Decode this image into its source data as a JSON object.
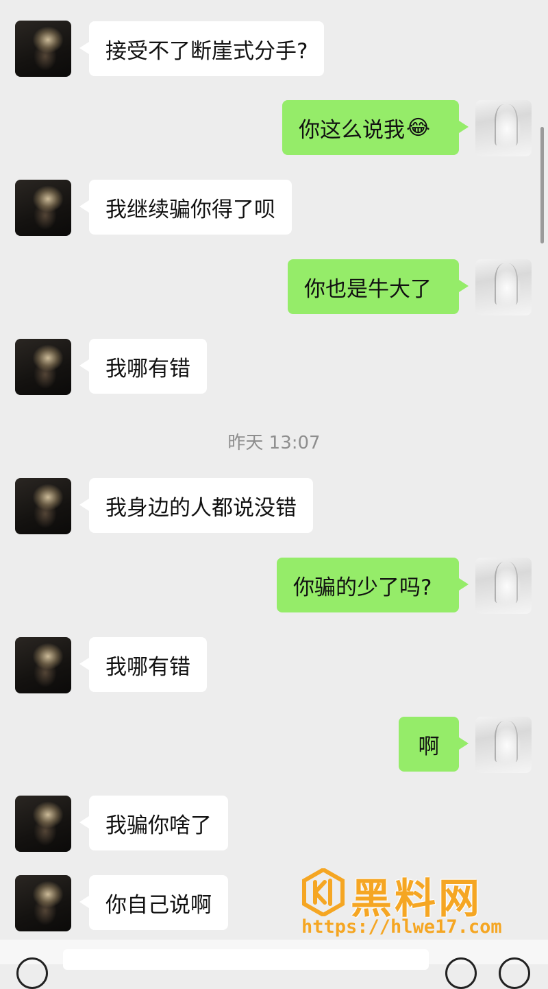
{
  "chat": {
    "messages": [
      {
        "from": "other",
        "text": "接受不了断崖式分手?"
      },
      {
        "from": "me",
        "text": "你这么说我",
        "emoji": "😂"
      },
      {
        "from": "other",
        "text": "我继续骗你得了呗"
      },
      {
        "from": "me",
        "text": "你也是牛大了"
      },
      {
        "from": "other",
        "text": "我哪有错"
      },
      {
        "from": "other",
        "text": "我身边的人都说没错"
      },
      {
        "from": "me",
        "text": "你骗的少了吗?"
      },
      {
        "from": "other",
        "text": "我哪有错"
      },
      {
        "from": "me",
        "text": "啊"
      },
      {
        "from": "other",
        "text": "我骗你啥了"
      },
      {
        "from": "other",
        "text": "你自己说啊"
      }
    ],
    "timestamp": "昨天 13:07"
  },
  "watermark": {
    "title": "黑料网",
    "url": "https://hlwe17.com"
  },
  "colors": {
    "background": "#ededed",
    "incoming_bubble": "#ffffff",
    "outgoing_bubble": "#95ec69",
    "watermark": "#f5a623"
  },
  "icons": {
    "voice": "voice-icon",
    "emoji": "emoji-icon",
    "plus": "plus-icon"
  }
}
